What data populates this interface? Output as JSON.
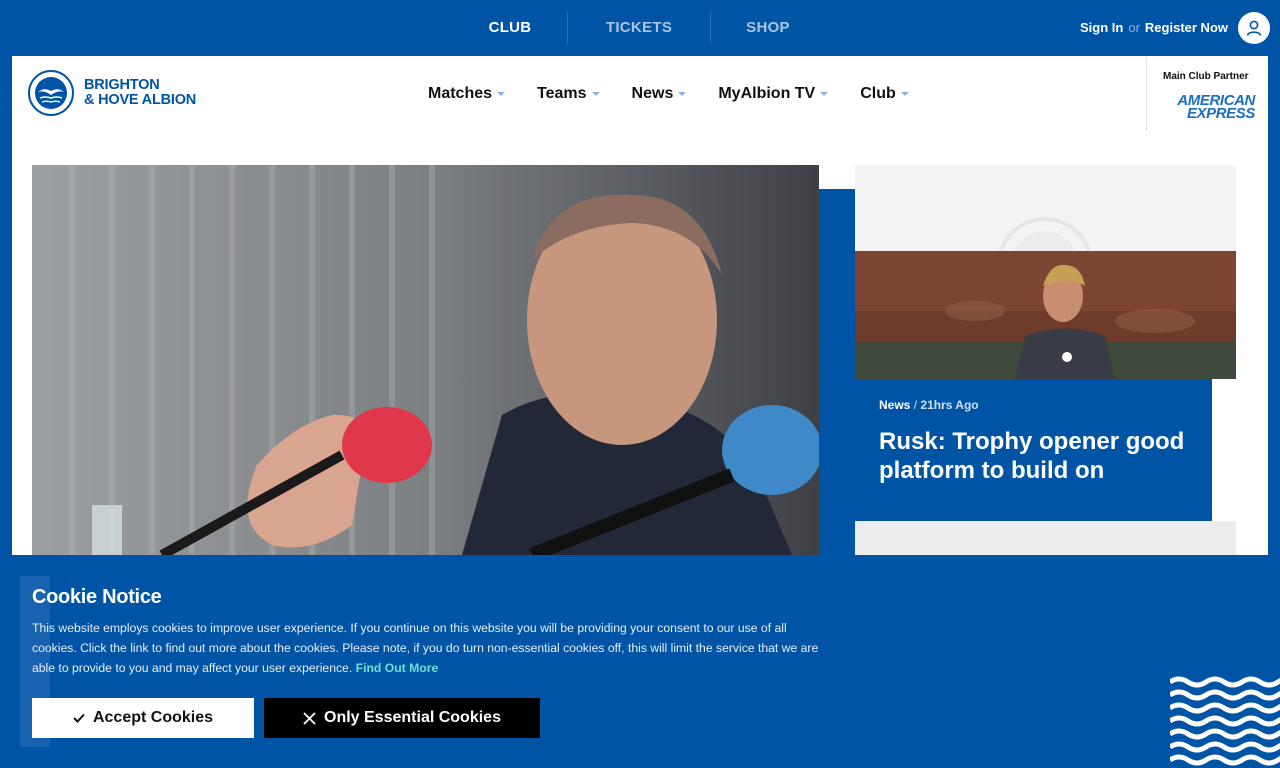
{
  "topnav": {
    "items": [
      {
        "label": "CLUB",
        "active": true
      },
      {
        "label": "TICKETS",
        "active": false
      },
      {
        "label": "SHOP",
        "active": false
      }
    ]
  },
  "auth": {
    "sign_in": "Sign In",
    "or": "or",
    "register": "Register Now"
  },
  "brand": {
    "line1": "BRIGHTON",
    "line2": "& HOVE ALBION"
  },
  "mainnav": {
    "items": [
      "Matches",
      "Teams",
      "News",
      "MyAlbion TV",
      "Club"
    ]
  },
  "partner": {
    "label": "Main Club Partner",
    "logo_line1": "AMERICAN",
    "logo_line2": "EXPRESS"
  },
  "side_article": {
    "category": "News",
    "separator": "/",
    "time": "21hrs Ago",
    "title": "Rusk: Trophy opener good platform to build on"
  },
  "cookie": {
    "title": "Cookie Notice",
    "body": "This website employs cookies to improve user experience. If you continue on this website you will be providing your consent to our use of all cookies. Click the link to find out more about the cookies. Please note, if you do turn non-essential cookies off, this will limit the service that we are able to provide to you and may affect your user experience.",
    "more_link": "Find Out More",
    "accept_label": "Accept Cookies",
    "essential_label": "Only Essential Cookies"
  },
  "colors": {
    "brand_blue": "#0054a6",
    "link_accent": "#6ee0d8",
    "white": "#ffffff",
    "black": "#000000"
  }
}
